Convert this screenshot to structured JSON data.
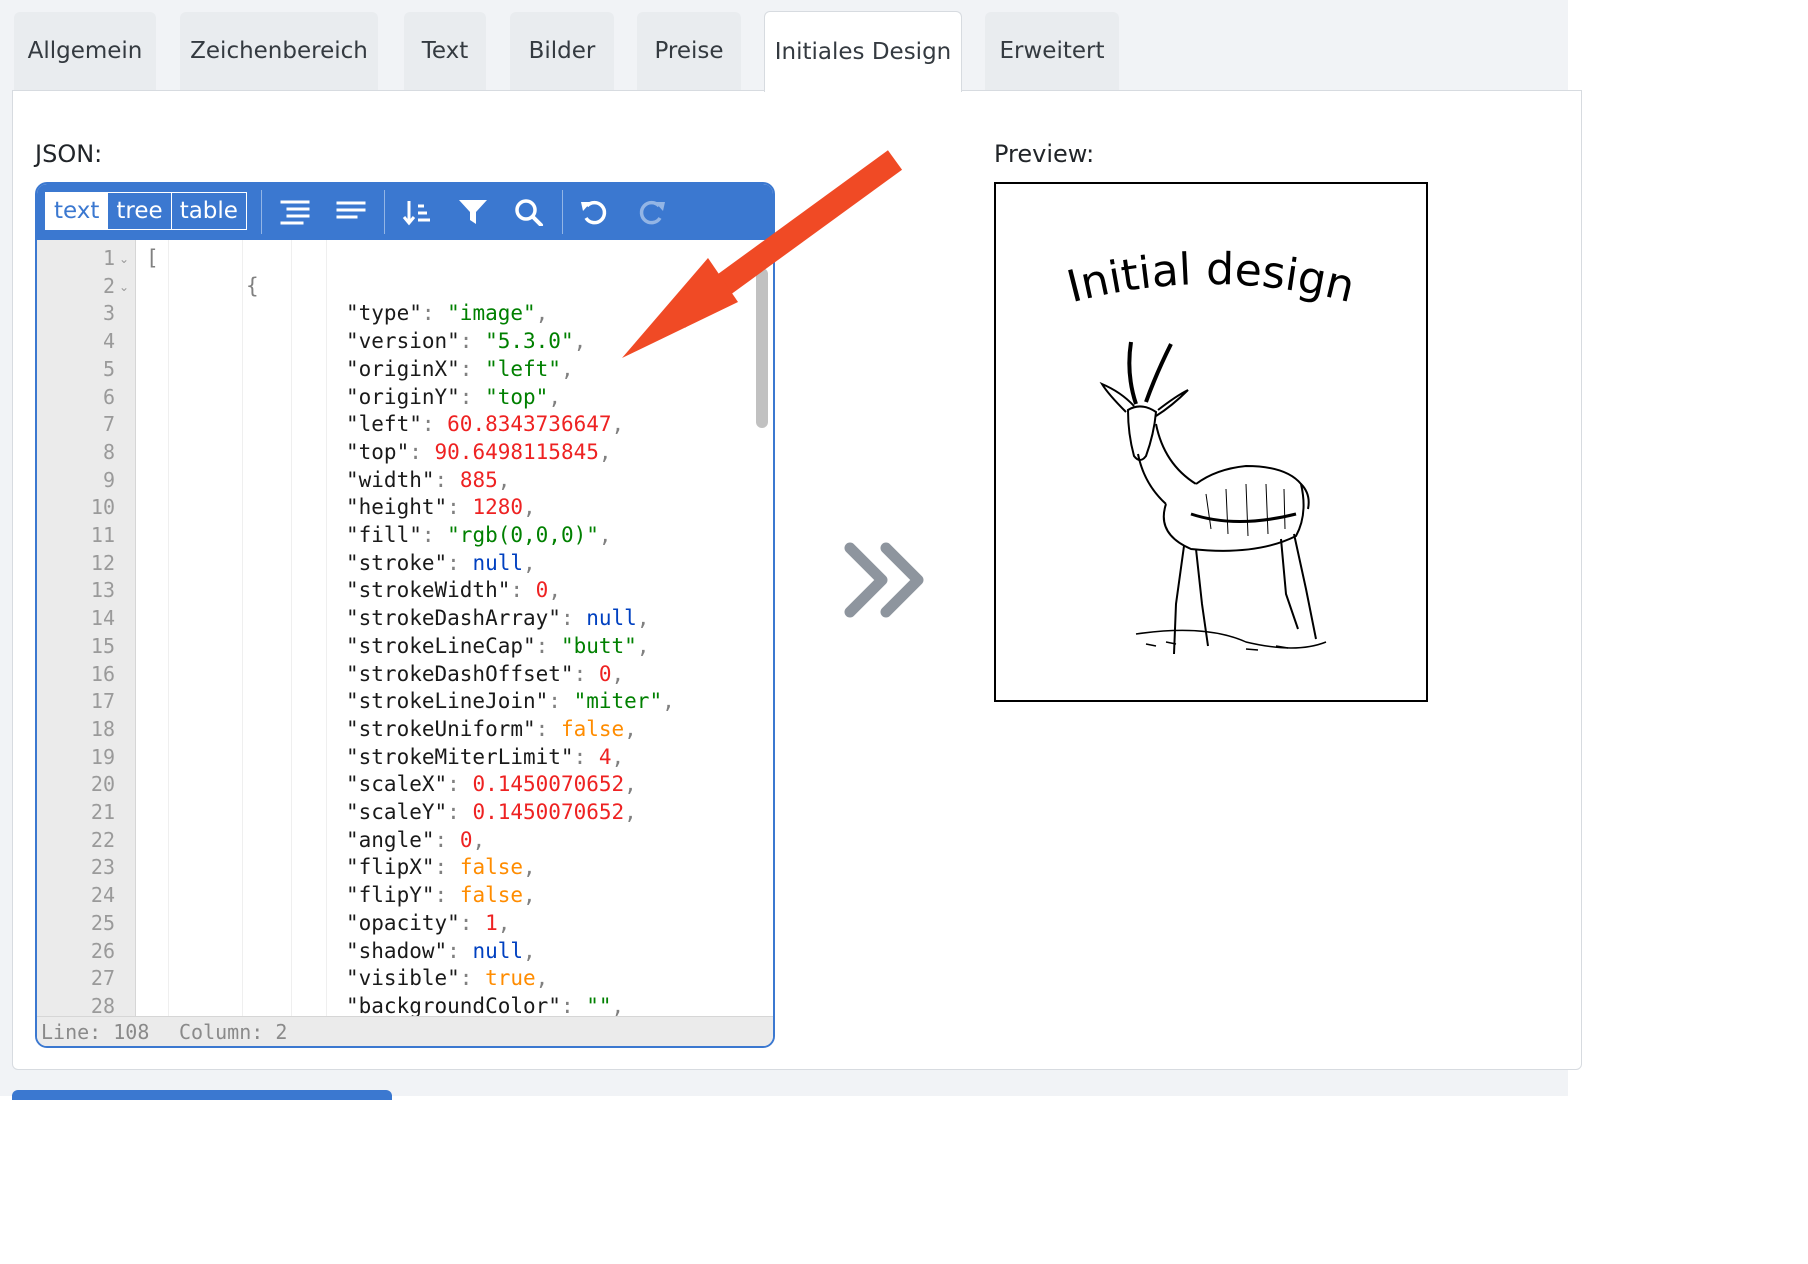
{
  "tabs": [
    {
      "label": "Allgemein",
      "active": false
    },
    {
      "label": "Zeichenbereich",
      "active": false
    },
    {
      "label": "Text",
      "active": false
    },
    {
      "label": "Bilder",
      "active": false
    },
    {
      "label": "Preise",
      "active": false
    },
    {
      "label": "Initiales Design",
      "active": true
    },
    {
      "label": "Erweitert",
      "active": false
    }
  ],
  "json_label": "JSON:",
  "preview_label": "Preview:",
  "editor": {
    "modes": [
      "text",
      "tree",
      "table"
    ],
    "active_mode": "text",
    "toolbar_icons": [
      "format-icon",
      "compact-icon",
      "sort-icon",
      "filter-icon",
      "search-icon",
      "undo-icon",
      "redo-icon"
    ],
    "status": {
      "line": "Line: 108",
      "column": "Column: 2"
    },
    "lines": [
      {
        "n": "1",
        "fold": true,
        "indent": 0,
        "tokens": [
          [
            "p",
            "["
          ]
        ]
      },
      {
        "n": "2",
        "fold": true,
        "indent": 1,
        "tokens": [
          [
            "p",
            "{"
          ]
        ]
      },
      {
        "n": "3",
        "indent": 2,
        "tokens": [
          [
            "k",
            "\"type\""
          ],
          [
            "p",
            ": "
          ],
          [
            "s",
            "\"image\""
          ],
          [
            "p",
            ","
          ]
        ]
      },
      {
        "n": "4",
        "indent": 2,
        "tokens": [
          [
            "k",
            "\"version\""
          ],
          [
            "p",
            ": "
          ],
          [
            "s",
            "\"5.3.0\""
          ],
          [
            "p",
            ","
          ]
        ]
      },
      {
        "n": "5",
        "indent": 2,
        "tokens": [
          [
            "k",
            "\"originX\""
          ],
          [
            "p",
            ": "
          ],
          [
            "s",
            "\"left\""
          ],
          [
            "p",
            ","
          ]
        ]
      },
      {
        "n": "6",
        "indent": 2,
        "tokens": [
          [
            "k",
            "\"originY\""
          ],
          [
            "p",
            ": "
          ],
          [
            "s",
            "\"top\""
          ],
          [
            "p",
            ","
          ]
        ]
      },
      {
        "n": "7",
        "indent": 2,
        "tokens": [
          [
            "k",
            "\"left\""
          ],
          [
            "p",
            ": "
          ],
          [
            "n",
            "60.8343736647"
          ],
          [
            "p",
            ","
          ]
        ]
      },
      {
        "n": "8",
        "indent": 2,
        "tokens": [
          [
            "k",
            "\"top\""
          ],
          [
            "p",
            ": "
          ],
          [
            "n",
            "90.6498115845"
          ],
          [
            "p",
            ","
          ]
        ]
      },
      {
        "n": "9",
        "indent": 2,
        "tokens": [
          [
            "k",
            "\"width\""
          ],
          [
            "p",
            ": "
          ],
          [
            "n",
            "885"
          ],
          [
            "p",
            ","
          ]
        ]
      },
      {
        "n": "10",
        "indent": 2,
        "tokens": [
          [
            "k",
            "\"height\""
          ],
          [
            "p",
            ": "
          ],
          [
            "n",
            "1280"
          ],
          [
            "p",
            ","
          ]
        ]
      },
      {
        "n": "11",
        "indent": 2,
        "tokens": [
          [
            "k",
            "\"fill\""
          ],
          [
            "p",
            ": "
          ],
          [
            "s",
            "\"rgb(0,0,0)\""
          ],
          [
            "p",
            ","
          ]
        ]
      },
      {
        "n": "12",
        "indent": 2,
        "tokens": [
          [
            "k",
            "\"stroke\""
          ],
          [
            "p",
            ": "
          ],
          [
            "nl",
            "null"
          ],
          [
            "p",
            ","
          ]
        ]
      },
      {
        "n": "13",
        "indent": 2,
        "tokens": [
          [
            "k",
            "\"strokeWidth\""
          ],
          [
            "p",
            ": "
          ],
          [
            "n",
            "0"
          ],
          [
            "p",
            ","
          ]
        ]
      },
      {
        "n": "14",
        "indent": 2,
        "tokens": [
          [
            "k",
            "\"strokeDashArray\""
          ],
          [
            "p",
            ": "
          ],
          [
            "nl",
            "null"
          ],
          [
            "p",
            ","
          ]
        ]
      },
      {
        "n": "15",
        "indent": 2,
        "tokens": [
          [
            "k",
            "\"strokeLineCap\""
          ],
          [
            "p",
            ": "
          ],
          [
            "s",
            "\"butt\""
          ],
          [
            "p",
            ","
          ]
        ]
      },
      {
        "n": "16",
        "indent": 2,
        "tokens": [
          [
            "k",
            "\"strokeDashOffset\""
          ],
          [
            "p",
            ": "
          ],
          [
            "n",
            "0"
          ],
          [
            "p",
            ","
          ]
        ]
      },
      {
        "n": "17",
        "indent": 2,
        "tokens": [
          [
            "k",
            "\"strokeLineJoin\""
          ],
          [
            "p",
            ": "
          ],
          [
            "s",
            "\"miter\""
          ],
          [
            "p",
            ","
          ]
        ]
      },
      {
        "n": "18",
        "indent": 2,
        "tokens": [
          [
            "k",
            "\"strokeUniform\""
          ],
          [
            "p",
            ": "
          ],
          [
            "b",
            "false"
          ],
          [
            "p",
            ","
          ]
        ]
      },
      {
        "n": "19",
        "indent": 2,
        "tokens": [
          [
            "k",
            "\"strokeMiterLimit\""
          ],
          [
            "p",
            ": "
          ],
          [
            "n",
            "4"
          ],
          [
            "p",
            ","
          ]
        ]
      },
      {
        "n": "20",
        "indent": 2,
        "tokens": [
          [
            "k",
            "\"scaleX\""
          ],
          [
            "p",
            ": "
          ],
          [
            "n",
            "0.1450070652"
          ],
          [
            "p",
            ","
          ]
        ]
      },
      {
        "n": "21",
        "indent": 2,
        "tokens": [
          [
            "k",
            "\"scaleY\""
          ],
          [
            "p",
            ": "
          ],
          [
            "n",
            "0.1450070652"
          ],
          [
            "p",
            ","
          ]
        ]
      },
      {
        "n": "22",
        "indent": 2,
        "tokens": [
          [
            "k",
            "\"angle\""
          ],
          [
            "p",
            ": "
          ],
          [
            "n",
            "0"
          ],
          [
            "p",
            ","
          ]
        ]
      },
      {
        "n": "23",
        "indent": 2,
        "tokens": [
          [
            "k",
            "\"flipX\""
          ],
          [
            "p",
            ": "
          ],
          [
            "b",
            "false"
          ],
          [
            "p",
            ","
          ]
        ]
      },
      {
        "n": "24",
        "indent": 2,
        "tokens": [
          [
            "k",
            "\"flipY\""
          ],
          [
            "p",
            ": "
          ],
          [
            "b",
            "false"
          ],
          [
            "p",
            ","
          ]
        ]
      },
      {
        "n": "25",
        "indent": 2,
        "tokens": [
          [
            "k",
            "\"opacity\""
          ],
          [
            "p",
            ": "
          ],
          [
            "n",
            "1"
          ],
          [
            "p",
            ","
          ]
        ]
      },
      {
        "n": "26",
        "indent": 2,
        "tokens": [
          [
            "k",
            "\"shadow\""
          ],
          [
            "p",
            ": "
          ],
          [
            "nl",
            "null"
          ],
          [
            "p",
            ","
          ]
        ]
      },
      {
        "n": "27",
        "indent": 2,
        "tokens": [
          [
            "k",
            "\"visible\""
          ],
          [
            "p",
            ": "
          ],
          [
            "b",
            "true"
          ],
          [
            "p",
            ","
          ]
        ]
      },
      {
        "n": "28",
        "indent": 2,
        "tokens": [
          [
            "k",
            "\"backgroundColor\""
          ],
          [
            "p",
            ": "
          ],
          [
            "s",
            "\"\""
          ],
          [
            "p",
            ","
          ]
        ]
      }
    ]
  },
  "preview": {
    "title": "Initial design",
    "image": "gazelle-illustration"
  },
  "colors": {
    "accent": "#3b78d0",
    "arrow": "#f04a25",
    "chevron": "#8e959e"
  }
}
